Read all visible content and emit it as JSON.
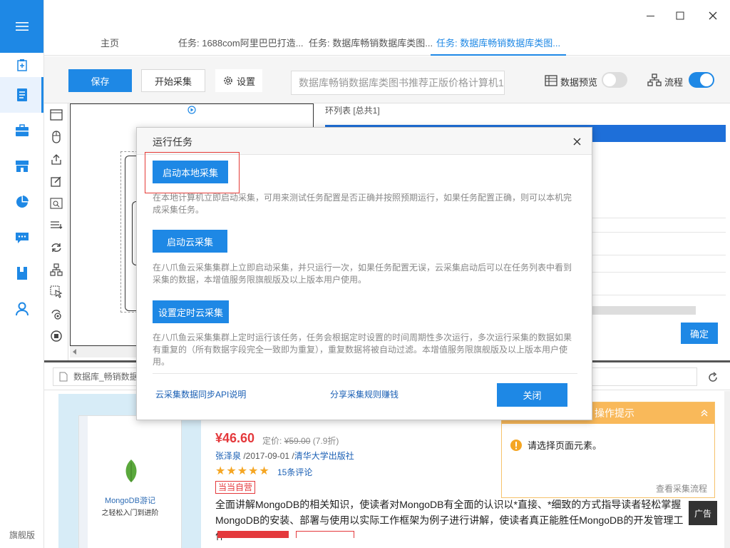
{
  "sidebar": {
    "edition": "旗舰版"
  },
  "tabs": [
    {
      "label": "主页"
    },
    {
      "label": "任务: 1688com阿里巴巴打造..."
    },
    {
      "label": "任务: 数据库畅销数据库类图..."
    },
    {
      "label": "任务: 数据库畅销数据库类图..."
    }
  ],
  "toolbar": {
    "save": "保存",
    "start_collect": "开始采集",
    "settings": "设置",
    "url_text": "数据库畅销数据库类图书推荐正版价格计算机1",
    "data_preview": "数据预览",
    "flow": "流程"
  },
  "workspace": {
    "loop_list": "环列表 [总共1]",
    "confirm": "确定"
  },
  "browser": {
    "address": "数据库_畅销数据"
  },
  "product": {
    "price": "¥46.60",
    "price_label": "定价:",
    "orig_price": "¥59.00",
    "discount": "(7.9折)",
    "author": "张泽泉",
    "date": " /2017-09-01 /",
    "publisher": "清华大学出版社",
    "stars": "★★★★★",
    "reviews": "15条评论",
    "badge": "当当自营",
    "desc": "全面讲解MongoDB的相关知识，使读者对MongoDB有全面的认识以*直接、*细致的方式指导读者轻松掌握MongoDB的安装、部署与使用以实际工作框架为例子进行讲解，使读者真正能胜任MongoDB的开发管理工作",
    "book_title": "MongoDB游记",
    "book_subtitle": "之轻松入门到进阶"
  },
  "hint": {
    "title": "操作提示",
    "message": "请选择页面元素。",
    "link": "查看采集流程"
  },
  "ad": "广告",
  "modal": {
    "title": "运行任务",
    "local_btn": "启动本地采集",
    "local_desc": "在本地计算机立即启动采集，可用来测试任务配置是否正确并按照预期运行，如果任务配置正确，则可以本机完成采集任务。",
    "cloud_btn": "启动云采集",
    "cloud_desc": "在八爪鱼云采集集群上立即启动采集，并只运行一次，如果任务配置无误，云采集启动后可以在任务列表中看到采集的数据，本增值服务限旗舰版及以上版本用户使用。",
    "schedule_btn": "设置定时云采集",
    "schedule_desc": "在八爪鱼云采集集群上定时运行该任务，任务会根据定时设置的时间周期性多次运行，多次运行采集的数据如果有重复的（所有数据字段完全一致即为重复），重复数据将被自动过滤。本增值服务限旗舰版及以上版本用户使用。",
    "api_link": "云采集数据同步API说明",
    "share_link": "分享采集规则赚钱",
    "close": "关闭"
  },
  "colors": {
    "accent": "#1e88e5",
    "price": "#e4393c",
    "hint": "#f9b95a"
  }
}
